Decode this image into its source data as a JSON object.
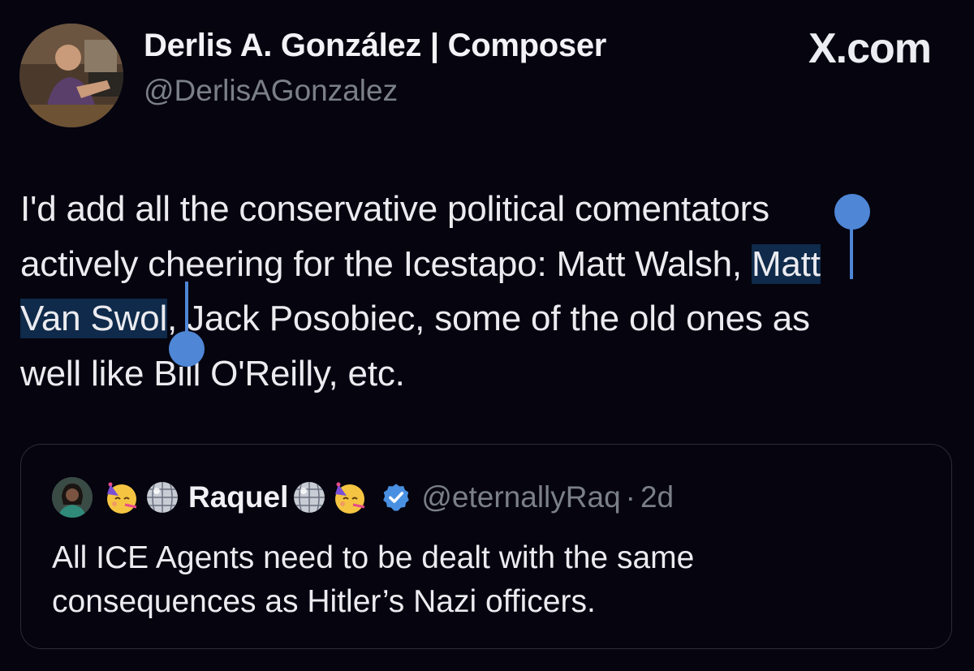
{
  "post": {
    "author": {
      "name": "Derlis A. González | Composer",
      "handle": "@DerlisAGonzalez"
    },
    "brand": "X.com",
    "body_lines": [
      {
        "before": "I'd add all the conservative political comentators",
        "selected": "",
        "after": ""
      },
      {
        "before": "actively cheering for the Icestapo: Matt Walsh, ",
        "selected": "Matt",
        "after": ""
      },
      {
        "before": "",
        "selected": "Van Swol",
        "after": ", Jack Posobiec, some of the old ones as"
      },
      {
        "before": "well like Bill O'Reilly, etc.",
        "selected": "",
        "after": ""
      }
    ]
  },
  "quoted_post": {
    "author": {
      "name": "Raquel",
      "handle": "@eternallyRaq",
      "verified": true,
      "emoji_prefix": [
        "partying-face-emoji",
        "mirror-ball-emoji"
      ],
      "emoji_suffix": [
        "mirror-ball-emoji",
        "partying-face-emoji"
      ]
    },
    "separator": "·",
    "time": "2d",
    "text_lines": [
      "All ICE Agents need to be dealt with the same",
      "consequences as Hitler’s Nazi officers."
    ]
  },
  "colors": {
    "background": "#05040f",
    "selection_highlight": "#0f2a4a",
    "selection_handle": "#4f86d6",
    "verified_badge": "#4a90e2",
    "muted_text": "#7b7f88"
  }
}
